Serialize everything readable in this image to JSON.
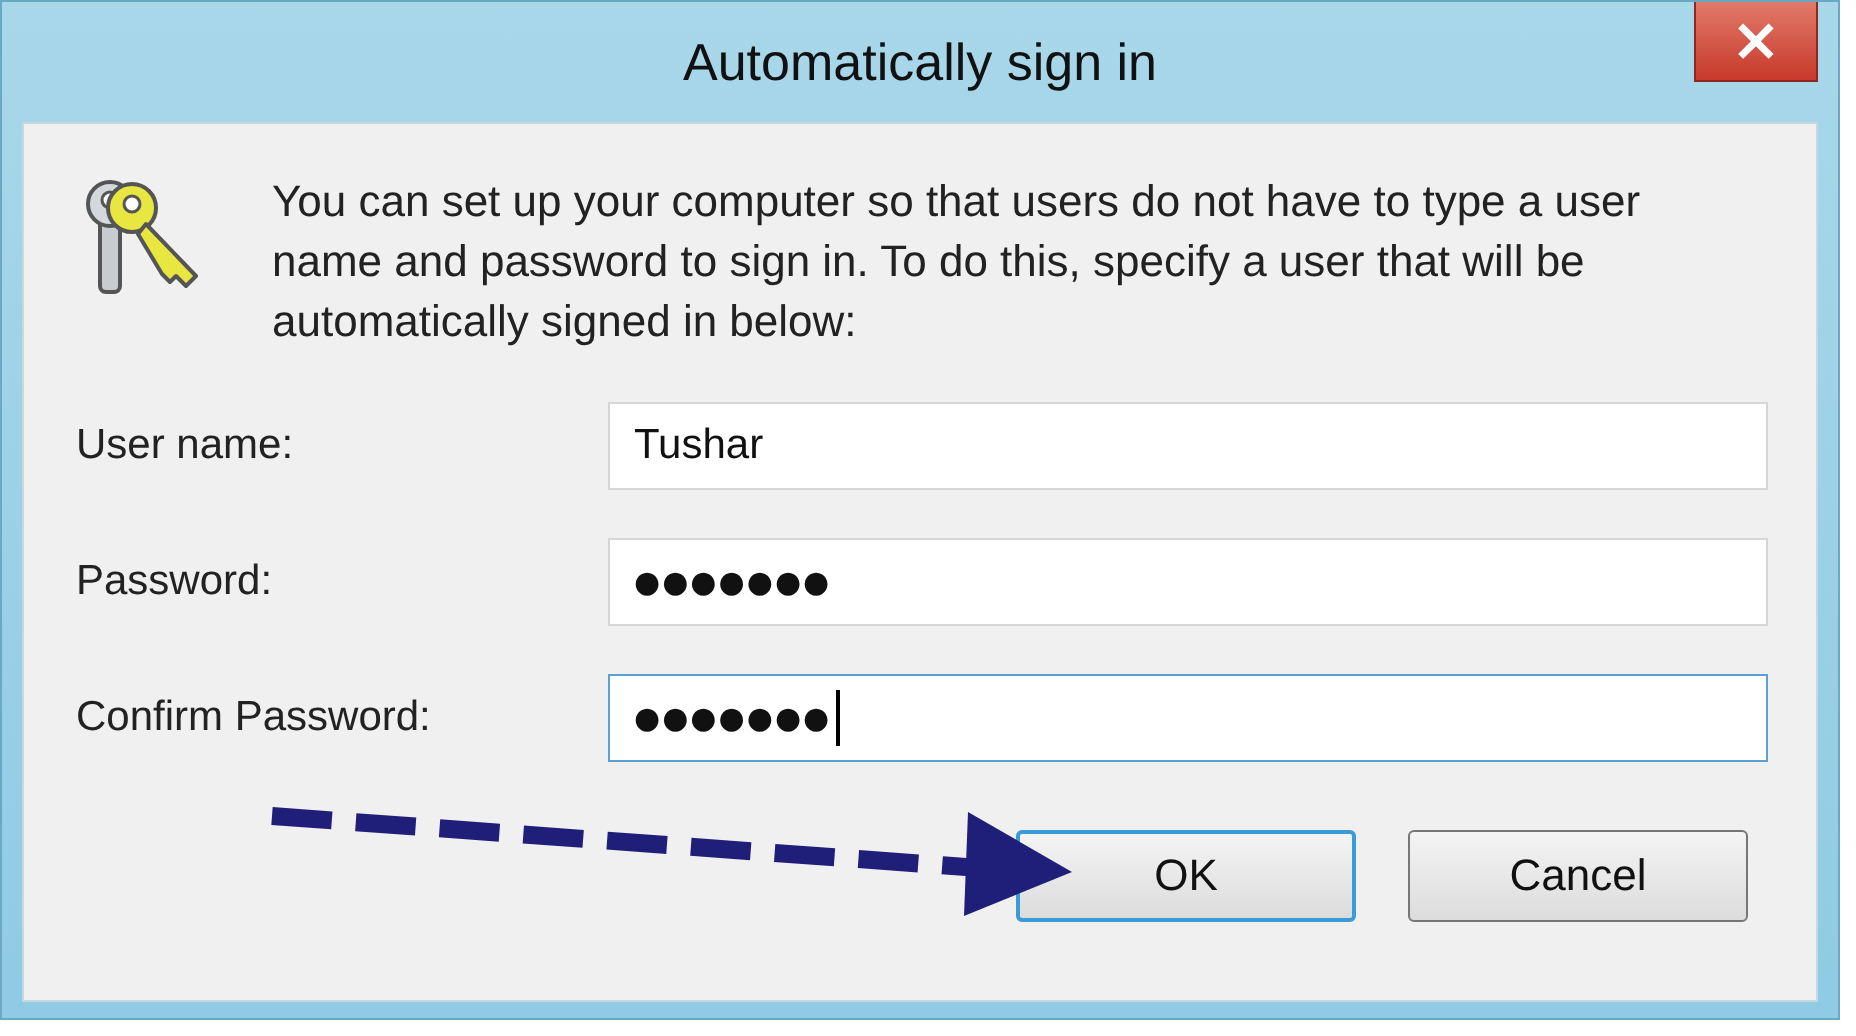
{
  "window": {
    "title": "Automatically sign in",
    "close_button": "×"
  },
  "message": "You can set up your computer so that users do not have to type a user name and password to sign in. To do this, specify a user that will be automatically signed in below:",
  "fields": [
    {
      "label": "User name:",
      "value": "Tushar",
      "kind": "text",
      "focused": false
    },
    {
      "label": "Password:",
      "value": "●●●●●●●",
      "kind": "password",
      "focused": false
    },
    {
      "label": "Confirm Password:",
      "value": "●●●●●●●",
      "kind": "password",
      "focused": true
    }
  ],
  "buttons": [
    {
      "label": "OK",
      "default": true
    },
    {
      "label": "Cancel",
      "default": false
    }
  ]
}
